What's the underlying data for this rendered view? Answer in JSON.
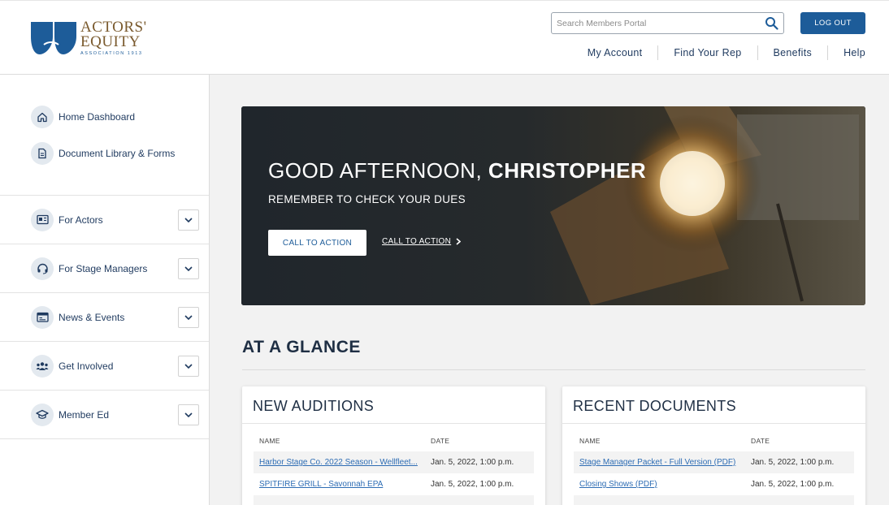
{
  "brand": {
    "line1": "ACTORS'",
    "line2": "EQUITY",
    "line3": "ASSOCIATION 1913",
    "primary_color": "#1d5c99",
    "gold_color": "#7a5a2e"
  },
  "header": {
    "search_placeholder": "Search Members Portal",
    "logout_label": "LOG OUT",
    "nav": [
      "My Account",
      "Find Your Rep",
      "Benefits",
      "Help"
    ]
  },
  "sidebar": {
    "links": [
      {
        "label": "Home Dashboard",
        "icon": "home-icon"
      },
      {
        "label": "Document Library & Forms",
        "icon": "document-icon"
      }
    ],
    "sections": [
      {
        "label": "For Actors",
        "icon": "id-card-icon"
      },
      {
        "label": "For Stage Managers",
        "icon": "headset-icon"
      },
      {
        "label": "News & Events",
        "icon": "calendar-icon"
      },
      {
        "label": "Get Involved",
        "icon": "group-icon"
      },
      {
        "label": "Member Ed",
        "icon": "graduation-cap-icon"
      }
    ]
  },
  "hero": {
    "greeting": "GOOD AFTERNOON,",
    "name": "CHRISTOPHER",
    "subtitle": "REMEMBER TO CHECK YOUR DUES",
    "button_label": "CALL TO ACTION",
    "link_label": "CALL TO ACTION"
  },
  "glance": {
    "title": "AT A GLANCE"
  },
  "auditions": {
    "title": "NEW AUDITIONS",
    "col_name": "NAME",
    "col_date": "DATE",
    "rows": [
      {
        "name": "Harbor Stage Co. 2022 Season - Wellfleet...",
        "date": "Jan. 5, 2022, 1:00 p.m."
      },
      {
        "name": "SPITFIRE GRILL - Savonnah EPA",
        "date": "Jan. 5, 2022, 1:00 p.m."
      }
    ]
  },
  "documents": {
    "title": "RECENT DOCUMENTS",
    "col_name": "NAME",
    "col_date": "DATE",
    "rows": [
      {
        "name": "Stage Manager Packet - Full Version (PDF)",
        "date": "Jan. 5, 2022, 1:00 p.m."
      },
      {
        "name": "Closing Shows (PDF)",
        "date": "Jan. 5, 2022, 1:00 p.m."
      }
    ]
  }
}
